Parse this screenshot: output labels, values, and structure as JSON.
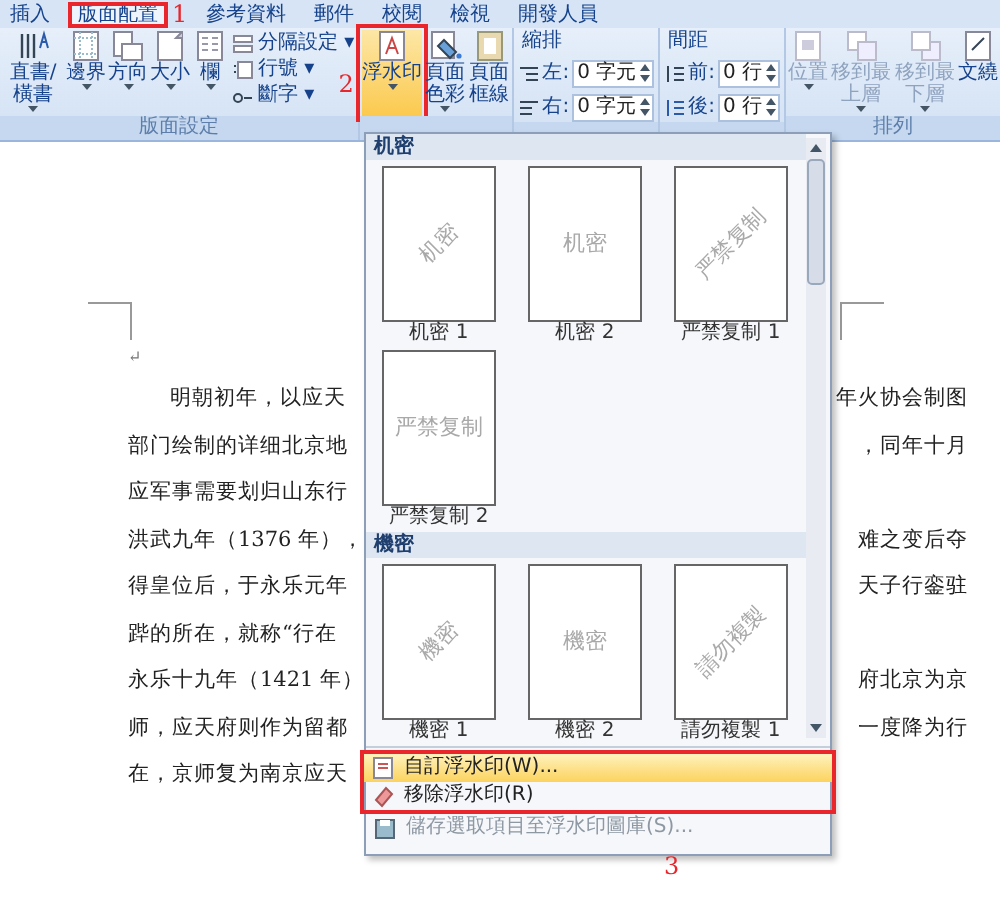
{
  "tabs": [
    {
      "label": "插入",
      "selected": false
    },
    {
      "label": "版面配置",
      "selected": true
    },
    {
      "label": "參考資料",
      "selected": false
    },
    {
      "label": "郵件",
      "selected": false
    },
    {
      "label": "校閱",
      "selected": false
    },
    {
      "label": "檢視",
      "selected": false
    },
    {
      "label": "開發人員",
      "selected": false
    }
  ],
  "ribbon": {
    "groups": [
      {
        "label": "版面設定",
        "kind": "buttons",
        "items": [
          {
            "kind": "large",
            "label": "直書/橫書",
            "menu": true,
            "disabled": false
          },
          {
            "kind": "large",
            "label": "邊界",
            "menu": true,
            "disabled": false
          },
          {
            "kind": "large",
            "label": "方向",
            "menu": true,
            "disabled": false
          },
          {
            "kind": "large",
            "label": "大小",
            "menu": true,
            "disabled": false
          },
          {
            "kind": "large",
            "label": "欄",
            "menu": true,
            "disabled": false
          },
          {
            "kind": "small-stack",
            "items": [
              {
                "label": "分隔設定 ▾"
              },
              {
                "label": "行號 ▾"
              },
              {
                "label": "斷字 ▾"
              }
            ]
          }
        ]
      },
      {
        "kind": "buttons",
        "items": [
          {
            "kind": "large",
            "label": "浮水印",
            "menu": true,
            "disabled": false,
            "pressed": true
          },
          {
            "kind": "large",
            "label": "頁面色彩",
            "menu": true,
            "disabled": false
          },
          {
            "kind": "large",
            "label": "頁面框線",
            "menu": false,
            "disabled": false
          }
        ]
      },
      {
        "kind": "fields",
        "title": "縮排",
        "items": [
          {
            "label": "左:",
            "value": "0 字元"
          },
          {
            "label": "右:",
            "value": "0 字元"
          }
        ]
      },
      {
        "kind": "fields",
        "title": "間距",
        "items": [
          {
            "label": "前:",
            "value": "0 行"
          },
          {
            "label": "後:",
            "value": "0 行"
          }
        ]
      },
      {
        "label": "排列",
        "kind": "buttons",
        "items": [
          {
            "kind": "large",
            "label": "位置",
            "menu": true,
            "disabled": true
          },
          {
            "kind": "large",
            "label": "移到最上層",
            "menu": true,
            "disabled": true
          },
          {
            "kind": "large",
            "label": "移到最下層",
            "menu": true,
            "disabled": true
          },
          {
            "kind": "large",
            "label": "文繞",
            "menu": false,
            "disabled": false
          }
        ]
      }
    ]
  },
  "document": {
    "paragraph_mark": "↵",
    "lines": [
      {
        "left": "明朝初年，以应天",
        "right": "年火协会制图",
        "indent": true
      },
      {
        "left": "部门绘制的详细北京地",
        "right": "，同年十月",
        "indent": false
      },
      {
        "left": "应军事需要划归山东行",
        "indent": false
      },
      {
        "left": "洪武九年（1376 年），",
        "right": "难之变后夺",
        "indent": false
      },
      {
        "left": "得皇位后，于永乐元年",
        "right": "天子行銮驻",
        "indent": false
      },
      {
        "left": "跸的所在，就称“行在",
        "indent": false
      },
      {
        "left": "永乐十九年（1421 年）",
        "right": "府北京为京",
        "indent": false
      },
      {
        "left": "师，应天府则作为留都",
        "right": "一度降为行",
        "indent": false
      },
      {
        "left": "在，京师复为南京应天",
        "indent": false
      }
    ]
  },
  "watermark_menu": {
    "sections": [
      {
        "title": "机密",
        "items": [
          {
            "caption": "机密 1",
            "mark": "机密",
            "kind": "diagonal"
          },
          {
            "caption": "机密 2",
            "mark": "机密",
            "kind": "horizontal"
          },
          {
            "caption": "严禁复制 1",
            "mark": "严禁复制",
            "kind": "diagonal"
          },
          {
            "caption": "严禁复制 2",
            "mark": "严禁复制",
            "kind": "horizontal"
          }
        ]
      },
      {
        "title": "機密",
        "items": [
          {
            "caption": "機密 1",
            "mark": "機密",
            "kind": "diagonal"
          },
          {
            "caption": "機密 2",
            "mark": "機密",
            "kind": "horizontal"
          },
          {
            "caption": "請勿複製 1",
            "mark": "請勿複製",
            "kind": "diagonal"
          }
        ]
      }
    ],
    "commands": [
      {
        "label": "自訂浮水印(W)...",
        "highlighted": true,
        "disabled": false
      },
      {
        "label": "移除浮水印(R)",
        "highlighted": false,
        "disabled": false
      },
      {
        "label": "儲存選取項目至浮水印圖庫(S)...",
        "highlighted": false,
        "disabled": true
      }
    ]
  },
  "annotations": [
    {
      "number": "1"
    },
    {
      "number": "2"
    },
    {
      "number": "3"
    }
  ]
}
